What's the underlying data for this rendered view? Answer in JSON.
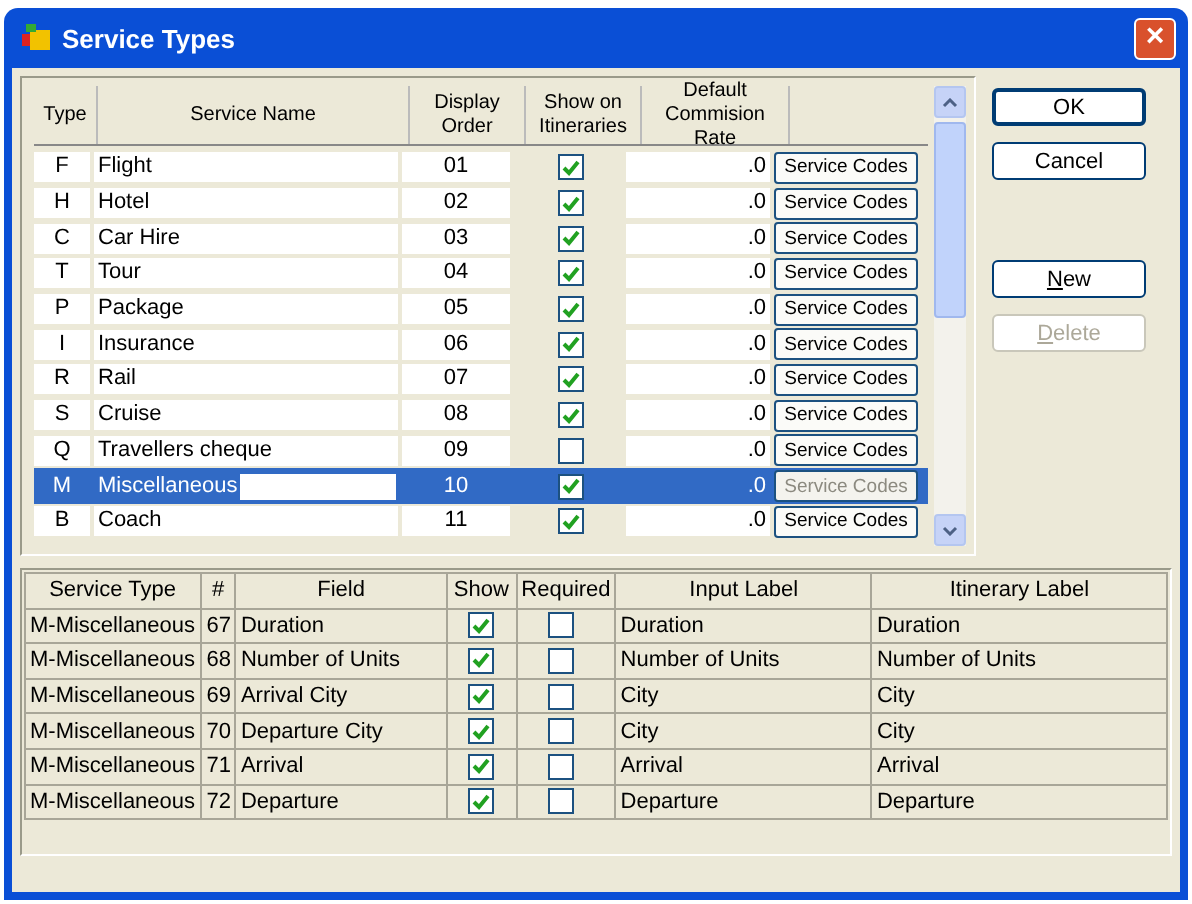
{
  "window": {
    "title": "Service Types",
    "close": "×"
  },
  "service_types": {
    "columns": [
      "Type",
      "Service Name",
      "Display Order",
      "Show on Itineraries",
      "Default Commision Rate"
    ],
    "rows": [
      {
        "type": "F",
        "name": "Flight",
        "order": "01",
        "show": true,
        "rate": ".0",
        "action": "Service Codes",
        "selected": false
      },
      {
        "type": "H",
        "name": "Hotel",
        "order": "02",
        "show": true,
        "rate": ".0",
        "action": "Service Codes",
        "selected": false
      },
      {
        "type": "C",
        "name": "Car Hire",
        "order": "03",
        "show": true,
        "rate": ".0",
        "action": "Service Codes",
        "selected": false
      },
      {
        "type": "T",
        "name": "Tour",
        "order": "04",
        "show": true,
        "rate": ".0",
        "action": "Service Codes",
        "selected": false
      },
      {
        "type": "P",
        "name": "Package",
        "order": "05",
        "show": true,
        "rate": ".0",
        "action": "Service Codes",
        "selected": false
      },
      {
        "type": "I",
        "name": "Insurance",
        "order": "06",
        "show": true,
        "rate": ".0",
        "action": "Service Codes",
        "selected": false
      },
      {
        "type": "R",
        "name": "Rail",
        "order": "07",
        "show": true,
        "rate": ".0",
        "action": "Service Codes",
        "selected": false
      },
      {
        "type": "S",
        "name": "Cruise",
        "order": "08",
        "show": true,
        "rate": ".0",
        "action": "Service Codes",
        "selected": false
      },
      {
        "type": "Q",
        "name": "Travellers cheque",
        "order": "09",
        "show": false,
        "rate": ".0",
        "action": "Service Codes",
        "selected": false
      },
      {
        "type": "M",
        "name": "Miscellaneous",
        "order": "10",
        "show": true,
        "rate": ".0",
        "action": "Service Codes",
        "selected": true
      },
      {
        "type": "B",
        "name": "Coach",
        "order": "11",
        "show": true,
        "rate": ".0",
        "action": "Service Codes",
        "selected": false
      }
    ]
  },
  "buttons": [
    {
      "label": "OK",
      "disabled": false,
      "default": true
    },
    {
      "label": "Cancel",
      "disabled": false,
      "default": false
    },
    {
      "label": "**N**ew",
      "disabled": false,
      "default": false
    },
    {
      "label": "**D**elete",
      "disabled": true,
      "default": false
    }
  ],
  "fields": {
    "columns": [
      "Service Type",
      "#",
      "Field",
      "Show",
      "Required",
      "Input Label",
      "Itinerary Label"
    ],
    "rows": [
      {
        "service_type": "M-Miscellaneous",
        "number": "67",
        "field": "Duration",
        "show": true,
        "required": false,
        "input_label": "Duration",
        "itinerary_label": "Duration"
      },
      {
        "service_type": "M-Miscellaneous",
        "number": "68",
        "field": "Number of Units",
        "show": true,
        "required": false,
        "input_label": "Number of Units",
        "itinerary_label": "Number of Units"
      },
      {
        "service_type": "M-Miscellaneous",
        "number": "69",
        "field": "Arrival City",
        "show": true,
        "required": false,
        "input_label": "City",
        "itinerary_label": "City"
      },
      {
        "service_type": "M-Miscellaneous",
        "number": "70",
        "field": "Departure City",
        "show": true,
        "required": false,
        "input_label": "City",
        "itinerary_label": "City"
      },
      {
        "service_type": "M-Miscellaneous",
        "number": "71",
        "field": "Arrival",
        "show": true,
        "required": false,
        "input_label": "Arrival",
        "itinerary_label": "Arrival"
      },
      {
        "service_type": "M-Miscellaneous",
        "number": "72",
        "field": "Departure",
        "show": true,
        "required": false,
        "input_label": "Departure",
        "itinerary_label": "Departure"
      }
    ]
  }
}
